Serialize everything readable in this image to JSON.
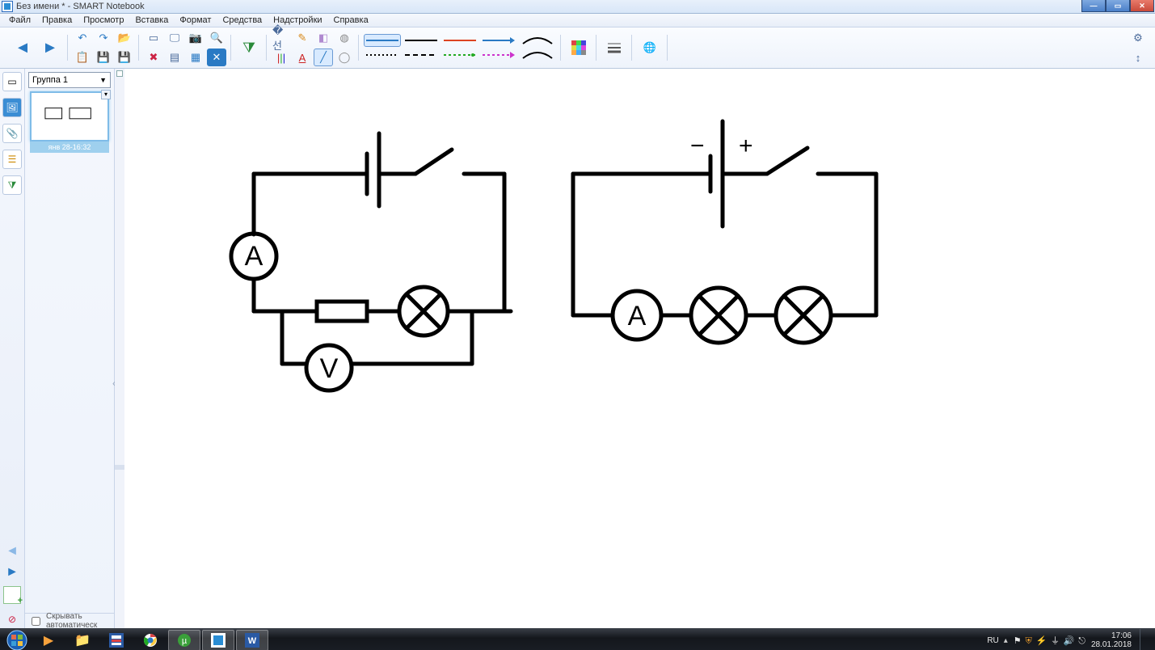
{
  "title": "Без имени * - SMART Notebook",
  "menu": [
    "Файл",
    "Правка",
    "Просмотр",
    "Вставка",
    "Формат",
    "Средства",
    "Надстройки",
    "Справка"
  ],
  "sidebar": {
    "group_label": "Группа 1",
    "thumb_caption": "янв 28-16:32",
    "auto_hide_label": "Скрывать автоматическ"
  },
  "taskbar": {
    "lang": "RU",
    "time": "17:06",
    "date": "28.01.2018"
  },
  "icons": {
    "back": "⬅",
    "forward": "➡",
    "undo": "↶",
    "redo": "↷",
    "folder": "📁",
    "delete": "✖",
    "copy": "📋",
    "save": "💾",
    "gear": "⚙",
    "vresize": "↕"
  },
  "diagram": {
    "circuits": [
      {
        "id": "circuit-left",
        "components": [
          {
            "type": "battery",
            "polarity_labels": false
          },
          {
            "type": "switch"
          },
          {
            "type": "ammeter",
            "label": "A"
          },
          {
            "type": "resistor"
          },
          {
            "type": "lamp"
          },
          {
            "type": "voltmeter",
            "label": "V"
          }
        ],
        "topology": "series-with-parallel-voltmeter"
      },
      {
        "id": "circuit-right",
        "components": [
          {
            "type": "battery",
            "polarity_labels": true,
            "minus": "−",
            "plus": "+"
          },
          {
            "type": "switch"
          },
          {
            "type": "ammeter",
            "label": "A"
          },
          {
            "type": "lamp"
          },
          {
            "type": "lamp"
          }
        ],
        "topology": "series-three-elements"
      }
    ]
  }
}
